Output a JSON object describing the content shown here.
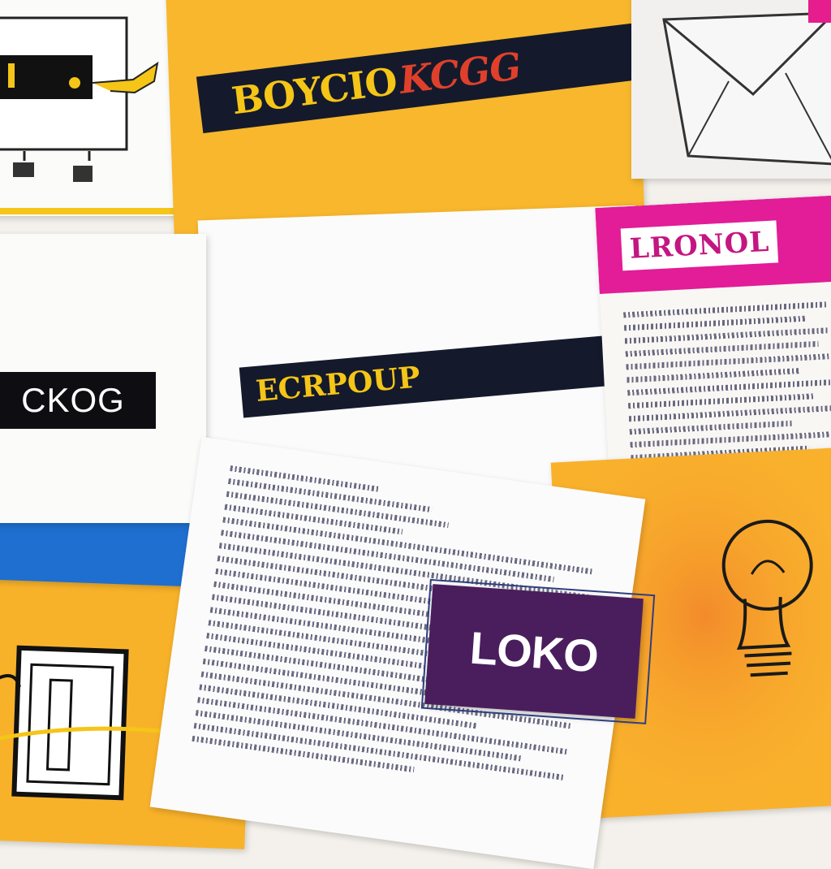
{
  "cards": {
    "top_banner_text": "BOYCIO",
    "top_banner_tail": "KCGG",
    "middle_banner_text": "ECRPOUP",
    "left_label_text": "CKOG",
    "right_header_text": "LRONOL",
    "bottom_label_text": "LOKO"
  },
  "colors": {
    "yellow": "#f8b72c",
    "magenta": "#e31c97",
    "navy": "#141a2c",
    "purple": "#4a1e5d",
    "blue": "#1f6fd0"
  },
  "icons": [
    "device-sketch-icon",
    "envelope-icon",
    "lightbulb-icon",
    "frame-sketch-icon"
  ]
}
